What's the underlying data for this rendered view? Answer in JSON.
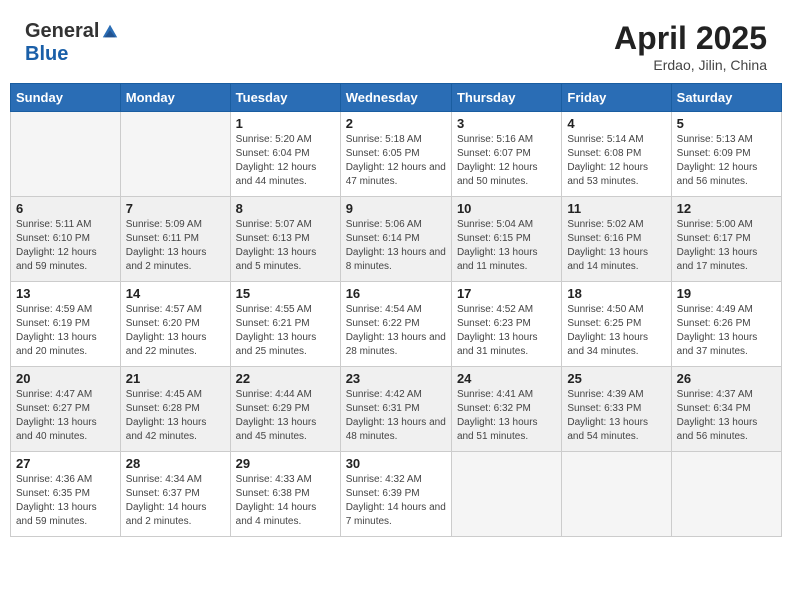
{
  "header": {
    "logo_general": "General",
    "logo_blue": "Blue",
    "month_title": "April 2025",
    "location": "Erdao, Jilin, China"
  },
  "weekdays": [
    "Sunday",
    "Monday",
    "Tuesday",
    "Wednesday",
    "Thursday",
    "Friday",
    "Saturday"
  ],
  "weeks": [
    [
      {
        "day": "",
        "empty": true
      },
      {
        "day": "",
        "empty": true
      },
      {
        "day": "1",
        "sunrise": "Sunrise: 5:20 AM",
        "sunset": "Sunset: 6:04 PM",
        "daylight": "Daylight: 12 hours and 44 minutes."
      },
      {
        "day": "2",
        "sunrise": "Sunrise: 5:18 AM",
        "sunset": "Sunset: 6:05 PM",
        "daylight": "Daylight: 12 hours and 47 minutes."
      },
      {
        "day": "3",
        "sunrise": "Sunrise: 5:16 AM",
        "sunset": "Sunset: 6:07 PM",
        "daylight": "Daylight: 12 hours and 50 minutes."
      },
      {
        "day": "4",
        "sunrise": "Sunrise: 5:14 AM",
        "sunset": "Sunset: 6:08 PM",
        "daylight": "Daylight: 12 hours and 53 minutes."
      },
      {
        "day": "5",
        "sunrise": "Sunrise: 5:13 AM",
        "sunset": "Sunset: 6:09 PM",
        "daylight": "Daylight: 12 hours and 56 minutes."
      }
    ],
    [
      {
        "day": "6",
        "sunrise": "Sunrise: 5:11 AM",
        "sunset": "Sunset: 6:10 PM",
        "daylight": "Daylight: 12 hours and 59 minutes."
      },
      {
        "day": "7",
        "sunrise": "Sunrise: 5:09 AM",
        "sunset": "Sunset: 6:11 PM",
        "daylight": "Daylight: 13 hours and 2 minutes."
      },
      {
        "day": "8",
        "sunrise": "Sunrise: 5:07 AM",
        "sunset": "Sunset: 6:13 PM",
        "daylight": "Daylight: 13 hours and 5 minutes."
      },
      {
        "day": "9",
        "sunrise": "Sunrise: 5:06 AM",
        "sunset": "Sunset: 6:14 PM",
        "daylight": "Daylight: 13 hours and 8 minutes."
      },
      {
        "day": "10",
        "sunrise": "Sunrise: 5:04 AM",
        "sunset": "Sunset: 6:15 PM",
        "daylight": "Daylight: 13 hours and 11 minutes."
      },
      {
        "day": "11",
        "sunrise": "Sunrise: 5:02 AM",
        "sunset": "Sunset: 6:16 PM",
        "daylight": "Daylight: 13 hours and 14 minutes."
      },
      {
        "day": "12",
        "sunrise": "Sunrise: 5:00 AM",
        "sunset": "Sunset: 6:17 PM",
        "daylight": "Daylight: 13 hours and 17 minutes."
      }
    ],
    [
      {
        "day": "13",
        "sunrise": "Sunrise: 4:59 AM",
        "sunset": "Sunset: 6:19 PM",
        "daylight": "Daylight: 13 hours and 20 minutes."
      },
      {
        "day": "14",
        "sunrise": "Sunrise: 4:57 AM",
        "sunset": "Sunset: 6:20 PM",
        "daylight": "Daylight: 13 hours and 22 minutes."
      },
      {
        "day": "15",
        "sunrise": "Sunrise: 4:55 AM",
        "sunset": "Sunset: 6:21 PM",
        "daylight": "Daylight: 13 hours and 25 minutes."
      },
      {
        "day": "16",
        "sunrise": "Sunrise: 4:54 AM",
        "sunset": "Sunset: 6:22 PM",
        "daylight": "Daylight: 13 hours and 28 minutes."
      },
      {
        "day": "17",
        "sunrise": "Sunrise: 4:52 AM",
        "sunset": "Sunset: 6:23 PM",
        "daylight": "Daylight: 13 hours and 31 minutes."
      },
      {
        "day": "18",
        "sunrise": "Sunrise: 4:50 AM",
        "sunset": "Sunset: 6:25 PM",
        "daylight": "Daylight: 13 hours and 34 minutes."
      },
      {
        "day": "19",
        "sunrise": "Sunrise: 4:49 AM",
        "sunset": "Sunset: 6:26 PM",
        "daylight": "Daylight: 13 hours and 37 minutes."
      }
    ],
    [
      {
        "day": "20",
        "sunrise": "Sunrise: 4:47 AM",
        "sunset": "Sunset: 6:27 PM",
        "daylight": "Daylight: 13 hours and 40 minutes."
      },
      {
        "day": "21",
        "sunrise": "Sunrise: 4:45 AM",
        "sunset": "Sunset: 6:28 PM",
        "daylight": "Daylight: 13 hours and 42 minutes."
      },
      {
        "day": "22",
        "sunrise": "Sunrise: 4:44 AM",
        "sunset": "Sunset: 6:29 PM",
        "daylight": "Daylight: 13 hours and 45 minutes."
      },
      {
        "day": "23",
        "sunrise": "Sunrise: 4:42 AM",
        "sunset": "Sunset: 6:31 PM",
        "daylight": "Daylight: 13 hours and 48 minutes."
      },
      {
        "day": "24",
        "sunrise": "Sunrise: 4:41 AM",
        "sunset": "Sunset: 6:32 PM",
        "daylight": "Daylight: 13 hours and 51 minutes."
      },
      {
        "day": "25",
        "sunrise": "Sunrise: 4:39 AM",
        "sunset": "Sunset: 6:33 PM",
        "daylight": "Daylight: 13 hours and 54 minutes."
      },
      {
        "day": "26",
        "sunrise": "Sunrise: 4:37 AM",
        "sunset": "Sunset: 6:34 PM",
        "daylight": "Daylight: 13 hours and 56 minutes."
      }
    ],
    [
      {
        "day": "27",
        "sunrise": "Sunrise: 4:36 AM",
        "sunset": "Sunset: 6:35 PM",
        "daylight": "Daylight: 13 hours and 59 minutes."
      },
      {
        "day": "28",
        "sunrise": "Sunrise: 4:34 AM",
        "sunset": "Sunset: 6:37 PM",
        "daylight": "Daylight: 14 hours and 2 minutes."
      },
      {
        "day": "29",
        "sunrise": "Sunrise: 4:33 AM",
        "sunset": "Sunset: 6:38 PM",
        "daylight": "Daylight: 14 hours and 4 minutes."
      },
      {
        "day": "30",
        "sunrise": "Sunrise: 4:32 AM",
        "sunset": "Sunset: 6:39 PM",
        "daylight": "Daylight: 14 hours and 7 minutes."
      },
      {
        "day": "",
        "empty": true
      },
      {
        "day": "",
        "empty": true
      },
      {
        "day": "",
        "empty": true
      }
    ]
  ]
}
